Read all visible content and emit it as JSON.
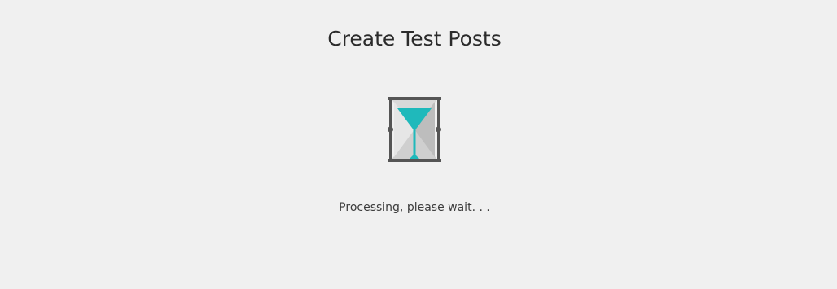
{
  "dialog": {
    "title": "Create Test Posts",
    "status_text": "Processing, please wait. . .",
    "icon": "hourglass-icon"
  },
  "colors": {
    "background": "#f0f0f0",
    "accent": "#1fb9bb",
    "frame": "#555555",
    "glass": "#cfcfcf"
  }
}
